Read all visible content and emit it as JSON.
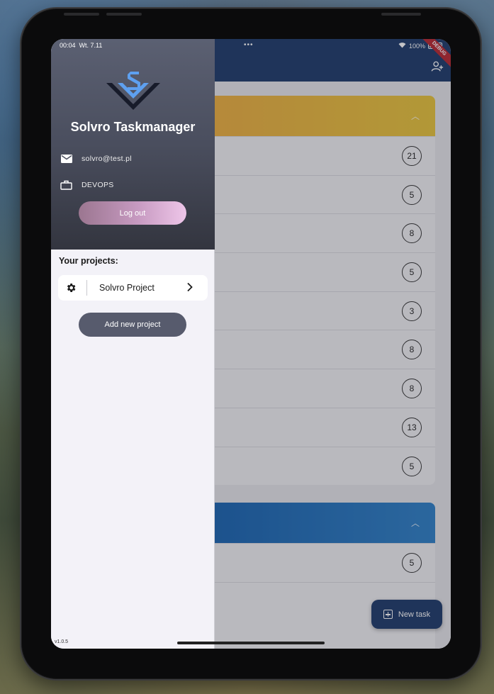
{
  "status_bar": {
    "time": "00:04",
    "date": "Wt. 7.11",
    "battery": "100%",
    "debug": "DEBUG",
    "dots": "•••"
  },
  "app": {
    "sections": [
      {
        "color_from": "#f0a040",
        "color_to": "#e8c43a",
        "points": [
          "21",
          "5",
          "8",
          "5",
          "3",
          "8",
          "8",
          "13",
          "5"
        ]
      },
      {
        "color_from": "#0a4fa0",
        "color_to": "#2d80c8",
        "points": [
          "5"
        ]
      }
    ],
    "fab_label": "New task"
  },
  "drawer": {
    "title": "Solvro Taskmanager",
    "email": "solvro@test.pl",
    "role": "DEVOPS",
    "logout_label": "Log out",
    "projects_title": "Your projects:",
    "projects": [
      {
        "name": "Solvro Project"
      }
    ],
    "add_project_label": "Add new project",
    "version": "v1.0.5"
  },
  "colors": {
    "header": "#1c3a6a",
    "drawer_bg": "#f3f2f8",
    "logout_accent": "#eec6e9",
    "logo_blue": "#5ea0f0"
  }
}
